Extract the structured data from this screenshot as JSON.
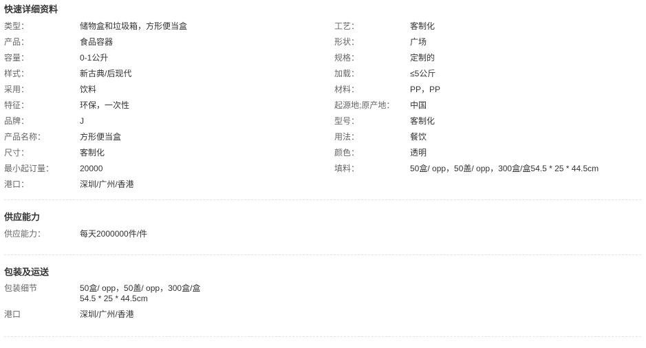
{
  "quick_details": {
    "title": "快速详细资料",
    "left": [
      {
        "label": "类型：",
        "value": "储物盒和垃圾箱，方形便当盒"
      },
      {
        "label": "产品：",
        "value": "食品容器"
      },
      {
        "label": "容量：",
        "value": "0-1公升"
      },
      {
        "label": "样式：",
        "value": "新古典/后现代"
      },
      {
        "label": "采用：",
        "value": "饮料"
      },
      {
        "label": "特征：",
        "value": "环保，一次性"
      },
      {
        "label": "品牌：",
        "value": "J"
      },
      {
        "label": "产品名称：",
        "value": "方形便当盒"
      },
      {
        "label": "尺寸：",
        "value": "客制化"
      },
      {
        "label": "最小起订量：",
        "value": "20000"
      },
      {
        "label": "港口：",
        "value": "深圳/广州/香港"
      }
    ],
    "right": [
      {
        "label": "工艺：",
        "value": "客制化"
      },
      {
        "label": "形状：",
        "value": "广场"
      },
      {
        "label": "规格：",
        "value": "定制的"
      },
      {
        "label": "加载：",
        "value": "≤5公斤"
      },
      {
        "label": "材料：",
        "value": "PP，PP"
      },
      {
        "label": "起源地;原产地：",
        "value": "中国"
      },
      {
        "label": "型号：",
        "value": "客制化"
      },
      {
        "label": "用法：",
        "value": "餐饮"
      },
      {
        "label": "颜色：",
        "value": "透明"
      },
      {
        "label": "填料：",
        "value": "50盒/ opp，50盖/ opp，300盒/盒54.5 * 25 * 44.5cm"
      }
    ]
  },
  "supply_ability": {
    "title": "供应能力",
    "rows": [
      {
        "label": "供应能力：",
        "value": "每天2000000件/件"
      }
    ]
  },
  "packaging": {
    "title": "包装及运送",
    "rows": [
      {
        "label": "包装细节",
        "value_lines": [
          "50盒/ opp，50盖/ opp，300盒/盒",
          "54.5 * 25 * 44.5cm"
        ]
      },
      {
        "label": "港口",
        "value": "深圳/广州/香港"
      }
    ]
  }
}
